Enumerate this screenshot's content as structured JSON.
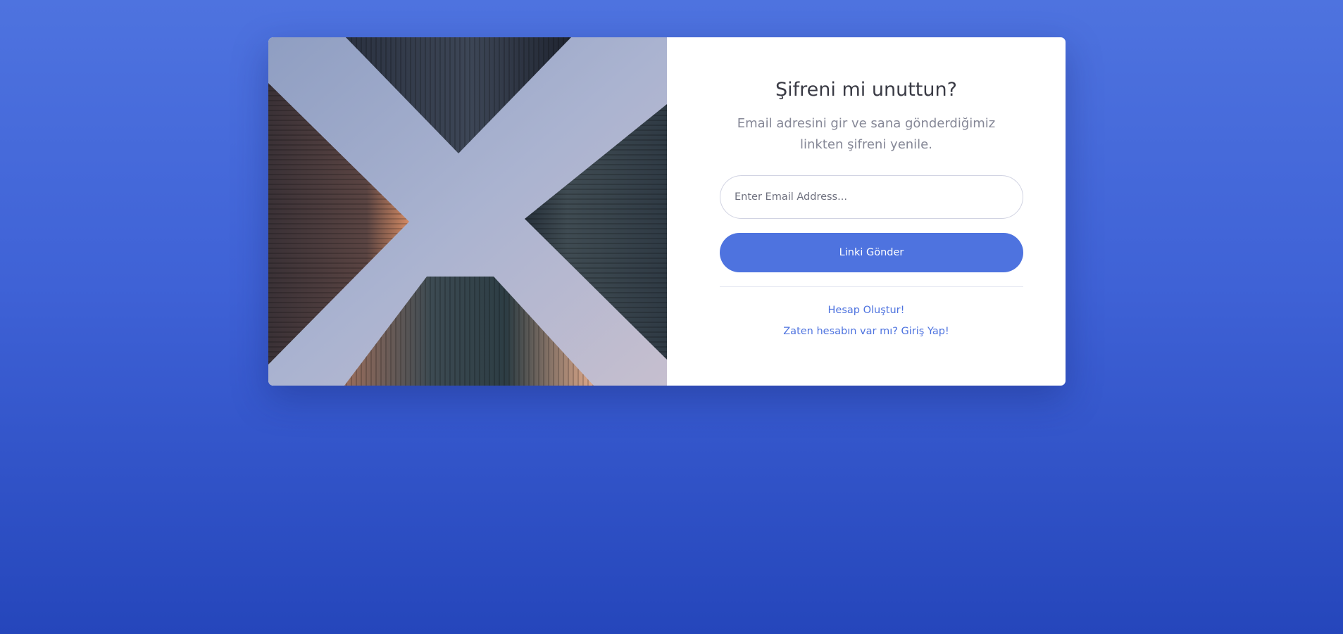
{
  "page": {
    "background_top": "#4e73df",
    "background_bottom": "#2546bb",
    "accent": "#4e73df"
  },
  "forgot_password": {
    "title": "Şifreni mi unuttun?",
    "subtitle": "Email adresini gir ve sana gönderdiğimiz linkten şifreni yenile.",
    "email_input": {
      "placeholder": "Enter Email Address...",
      "value": ""
    },
    "submit_label": "Linki Gönder",
    "links": {
      "register": "Hesap Oluştur!",
      "login": "Zaten hesabın var mı? Giriş Yap!"
    }
  },
  "image": {
    "description_icon": "skyscrapers-looking-up-photo"
  }
}
